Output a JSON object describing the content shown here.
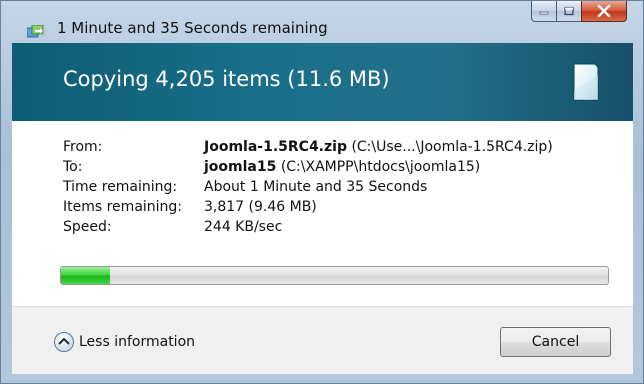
{
  "window": {
    "title": "1 Minute and 35 Seconds remaining",
    "controls": {
      "minimize_icon": "minimize-icon",
      "maximize_icon": "maximize-icon",
      "close_icon": "close-icon"
    }
  },
  "banner": {
    "heading": "Copying 4,205 items (11.6 MB)",
    "icon": "document-icon"
  },
  "details": {
    "from": {
      "label": "From:",
      "name": "Joomla-1.5RC4.zip",
      "path": "(C:\\Use...\\Joomla-1.5RC4.zip)"
    },
    "to": {
      "label": "To:",
      "name": "joomla15",
      "path": "(C:\\XAMPP\\htdocs\\joomla15)"
    },
    "time_remaining": {
      "label": "Time remaining:",
      "value": "About 1 Minute and 35 Seconds"
    },
    "items_remaining": {
      "label": "Items remaining:",
      "value": "3,817 (9.46 MB)"
    },
    "speed": {
      "label": "Speed:",
      "value": "244 KB/sec"
    }
  },
  "progress": {
    "fraction": 0.09,
    "color": "#22c022"
  },
  "footer": {
    "less_info_label": "Less information",
    "less_info_icon": "chevron-up-icon",
    "cancel_label": "Cancel"
  }
}
